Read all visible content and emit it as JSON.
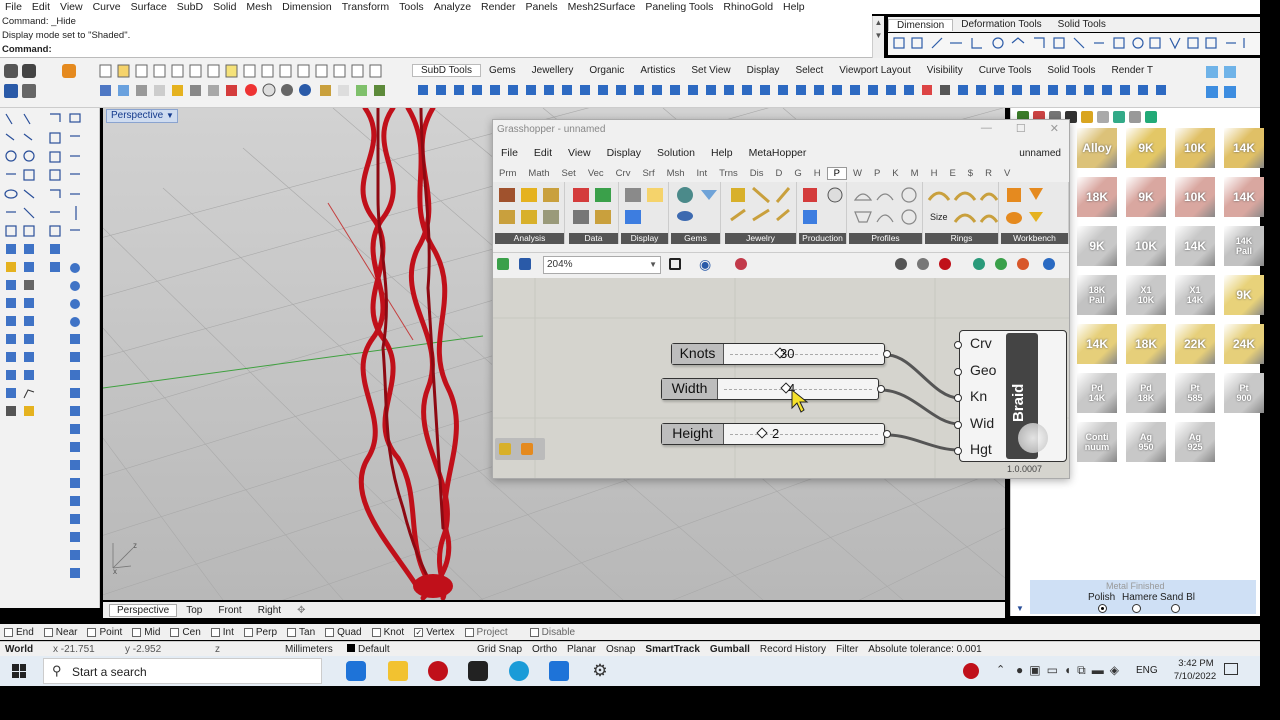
{
  "menubar": [
    "File",
    "Edit",
    "View",
    "Curve",
    "Surface",
    "SubD",
    "Solid",
    "Mesh",
    "Dimension",
    "Transform",
    "Tools",
    "Analyze",
    "Render",
    "Panels",
    "Mesh2Surface",
    "Paneling Tools",
    "RhinoGold",
    "Help"
  ],
  "command": {
    "line1": "Command: _Hide",
    "line2": "Display mode set to \"Shaded\".",
    "prompt": "Command:"
  },
  "right_tabs": [
    "Dimension",
    "Deformation Tools",
    "Solid Tools"
  ],
  "toolbar_tabs": [
    "SubD Tools",
    "Gems",
    "Jewellery",
    "Organic",
    "Artistics",
    "Set View",
    "Display",
    "Select",
    "Viewport Layout",
    "Visibility",
    "Curve Tools",
    "Solid Tools",
    "Render T"
  ],
  "viewport": {
    "title": "Perspective",
    "axis_x": "x",
    "axis_z": "z",
    "tabs": [
      "Perspective",
      "Top",
      "Front",
      "Right"
    ]
  },
  "grasshopper": {
    "title": "Grasshopper - unnamed",
    "menu": [
      "File",
      "Edit",
      "View",
      "Display",
      "Solution",
      "Help",
      "MetaHopper"
    ],
    "doc_name": "unnamed",
    "tabs": [
      "Prm",
      "Math",
      "Set",
      "Vec",
      "Crv",
      "Srf",
      "Msh",
      "Int",
      "Trns",
      "Dis",
      "D",
      "G",
      "H",
      "P",
      "W",
      "P",
      "K",
      "M",
      "H",
      "E",
      "$",
      "R",
      "V"
    ],
    "ribbon_groups": [
      "Analysis",
      "Data",
      "Display",
      "Gems",
      "Jewelry",
      "Production",
      "Profiles",
      "Rings",
      "Workbench"
    ],
    "ribbon_size_label": "Size",
    "zoom": "204%",
    "sliders": [
      {
        "name": "Knots",
        "value": "30"
      },
      {
        "name": "Width",
        "value": "4"
      },
      {
        "name": "Height",
        "value": "2"
      }
    ],
    "component": {
      "name": "Braid",
      "inputs": [
        "Crv",
        "Geo",
        "Kn",
        "Wid",
        "Hgt"
      ]
    },
    "version": "1.0.0007"
  },
  "materials": [
    [
      "Alloy",
      "9K",
      "10K",
      "14K"
    ],
    [
      "18K",
      "9K",
      "10K",
      "14K"
    ],
    [
      "9K",
      "10K",
      "14K",
      "14K\nPall"
    ],
    [
      "18K\nPall",
      "X1\n10K",
      "X1\n14K",
      "9K"
    ],
    [
      "14K",
      "18K",
      "22K",
      "24K"
    ],
    [
      "Pd\n14K",
      "Pd\n18K",
      "Pt\n585",
      "Pt\n900"
    ],
    [
      "Conti\nnuum",
      "Ag\n950",
      "Ag\n925"
    ]
  ],
  "finish": {
    "title": "Metal Finished",
    "options": [
      "Polish",
      "Hamere",
      "Sand Bl"
    ]
  },
  "osnaps": [
    {
      "label": "End",
      "on": false
    },
    {
      "label": "Near",
      "on": false
    },
    {
      "label": "Point",
      "on": false
    },
    {
      "label": "Mid",
      "on": false
    },
    {
      "label": "Cen",
      "on": false
    },
    {
      "label": "Int",
      "on": false
    },
    {
      "label": "Perp",
      "on": false
    },
    {
      "label": "Tan",
      "on": false
    },
    {
      "label": "Quad",
      "on": false
    },
    {
      "label": "Knot",
      "on": false
    },
    {
      "label": "Vertex",
      "on": true
    },
    {
      "label": "Project",
      "on": false
    },
    {
      "label": "Disable",
      "on": false
    }
  ],
  "status": {
    "cplane": "World",
    "x": "x -21.751",
    "y": "y -2.952",
    "z": "z",
    "units": "Millimeters",
    "layer": "Default",
    "toggles": [
      "Grid Snap",
      "Ortho",
      "Planar",
      "Osnap",
      "SmartTrack",
      "Gumball",
      "Record History",
      "Filter"
    ],
    "tolerance": "Absolute tolerance: 0.001"
  },
  "taskbar": {
    "search": "Start a search",
    "lang": "ENG",
    "time": "3:42 PM",
    "date": "7/10/2022"
  },
  "colors": {
    "braid": "#c0101a",
    "accent": "#143a8c",
    "canvas": "#d5d4ce"
  }
}
